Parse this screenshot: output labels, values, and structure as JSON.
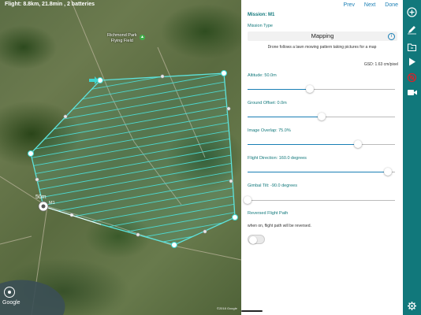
{
  "map": {
    "flight_info": "Flight: 8.8km, 21.8min , 2 batteries",
    "park_label_line1": "Richmond Park",
    "park_label_line2": "Flying Field",
    "altitude_label": "50m",
    "waypoint_label": "M1",
    "google_logo": "Google",
    "copyright": "©2018 Google"
  },
  "nav": {
    "prev": "Prev",
    "next": "Next",
    "done": "Done"
  },
  "panel": {
    "mission_title": "Mission: M1",
    "mission_type_label": "Mission Type",
    "mission_type_value": "Mapping",
    "mission_description": "Drone follows a lawn mowing pattern taking pictures for a map",
    "gsd": "GSD: 1.63 cm/pixel",
    "sliders": [
      {
        "label": "Altitude: 50.0m",
        "fraction": 0.42
      },
      {
        "label": "Ground Offset: 0.0m",
        "fraction": 0.5
      },
      {
        "label": "Image Overlap: 75.0%",
        "fraction": 0.75
      },
      {
        "label": "Flight Direction: 160.0 degrees",
        "fraction": 0.95
      },
      {
        "label": "Gimbal Tilt: -90.0 degrees",
        "fraction": 0.0
      }
    ],
    "reversed_label": "Reversed Flight Path",
    "reversed_note": "when on, flight path will be reversed.",
    "reversed_on": false
  },
  "toolbar": {
    "icons": [
      "add-icon",
      "draw-icon",
      "folder-icon",
      "play-icon",
      "no-fly-icon",
      "video-icon",
      "settings-icon"
    ]
  },
  "colors": {
    "accent": "#11787b",
    "link": "#1a7fb5",
    "survey": "#3fd6d0",
    "warning": "#d9222a"
  }
}
